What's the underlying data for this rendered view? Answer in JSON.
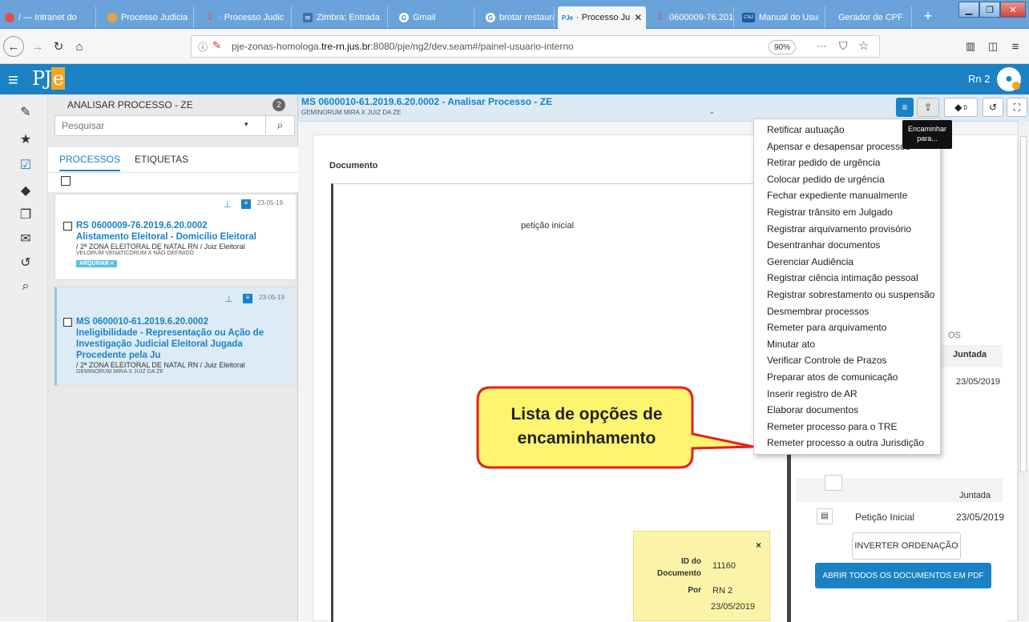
{
  "browser": {
    "tabs": [
      {
        "label": "/ — Intranet do",
        "icon": "globe-icon",
        "color": "#d9534f"
      },
      {
        "label": "Processo Judicia",
        "icon": "globe-icon",
        "color": "#e9a23b"
      },
      {
        "label": "· Processo Judic",
        "icon": "pin-icon",
        "color": "#d9534f"
      },
      {
        "label": "Zimbra: Entrada",
        "icon": "mail-icon",
        "color": "#3c6eb4"
      },
      {
        "label": "Gmail",
        "icon": "google-icon",
        "color": "#ffffff"
      },
      {
        "label": "brotar restauran",
        "icon": "google-icon",
        "color": "#ffffff"
      },
      {
        "label": "· Processo Ju",
        "icon": "pje-icon",
        "color": "#1a82c4"
      },
      {
        "label": "0600009-76.201",
        "icon": "pin-icon",
        "color": "#d9534f"
      },
      {
        "label": "Manual do Usu",
        "icon": "cnj-icon",
        "color": "#1a5aa8"
      },
      {
        "label": "Gerador de CPF",
        "icon": "",
        "color": ""
      }
    ],
    "url_prefix": "pje-zonas-homologa.",
    "url_host": "tre-rn.jus.br",
    "url_suffix": ":8080/pje/ng2/dev.seam#/painel-usuario-interno",
    "zoom": "90%",
    "page_actions": "···"
  },
  "app": {
    "logo": "PJe",
    "user_label": "Rn 2",
    "accent": "#1a82c4"
  },
  "sidebar": {
    "title": "ANALISAR PROCESSO - ZE",
    "badge": "2",
    "search_placeholder": "Pesquisar",
    "tab_processos": "PROCESSOS",
    "tab_etiquetas": "ETIQUETAS"
  },
  "cards": [
    {
      "date": "23-05-19",
      "number": "RS 0600009-76.2019.6.20.0002",
      "title": "Alistamento Eleitoral - Domicílio Eleitoral",
      "origin": "/ 2ª ZONA ELEITORAL DE NATAL RN / Juiz Eleitoral",
      "parties": "VELORUM VENATICORUM X NÃO DEFINIDO",
      "tag": "ARQUIVAR ×"
    },
    {
      "date": "23-05-19",
      "number": "MS 0600010-61.2019.6.20.0002",
      "title": "Ineligibilidade - Representação ou Ação de Investigação Judicial Eleitoral Jugada Procedente pela Ju",
      "origin": "/ 2ª ZONA ELEITORAL DE NATAL RN / Juiz Eleitoral",
      "parties": "GEMINORUM MIRA X JUIZ DA ZE"
    }
  ],
  "doc": {
    "header_title": "MS 0600010-61.2019.6.20.0002 - Analisar Processo - ZE",
    "header_sub": "GEMINORUM MIRA X JUIZ DA ZE",
    "label": "Documento",
    "page_text": "petição inicial",
    "tag_count": "0"
  },
  "menu": {
    "items": [
      "Retificar autuação",
      "Apensar e desapensar processos",
      "Retirar pedido de urgência",
      "Colocar pedido de urgência",
      "Fechar expediente manualmente",
      "Registrar trânsito em Julgado",
      "Registrar arquivamento provisório",
      "Desentranhar documentos",
      "Gerenciar Audiência",
      "Registrar ciência intimação pessoal",
      "Registrar sobrestamento ou suspensão",
      "Desmembrar processos",
      "Remeter para arquivamento",
      "Minutar ato",
      "Verificar Controle de Prazos",
      "Preparar atos de comunicação",
      "Inserir registro de AR",
      "Elaborar documentos",
      "Remeter processo para o TRE",
      "Remeter processo a outra Jurisdição"
    ],
    "tooltip": "Encaminhar para..."
  },
  "right_panel": {
    "partial_header": "OS",
    "col_juntada": "Juntada",
    "row_date": "23/05/2019",
    "col_juntada2": "Juntada",
    "doc_name": "Petição Inicial",
    "doc_date": "23/05/2019",
    "invert_button": "INVERTER ORDENAÇÃO",
    "pdf_button": "ABRIR TODOS OS DOCUMENTOS EM PDF"
  },
  "callout": {
    "line1": "Lista de opções de",
    "line2": "encaminhamento",
    "fill": "#fff46e",
    "stroke": "#e51f1f"
  },
  "info": {
    "id_label": "ID do Documento",
    "id_value": "11160",
    "por_label": "Por",
    "por_value": "RN 2",
    "date_value": "23/05/2019",
    "close": "×"
  }
}
